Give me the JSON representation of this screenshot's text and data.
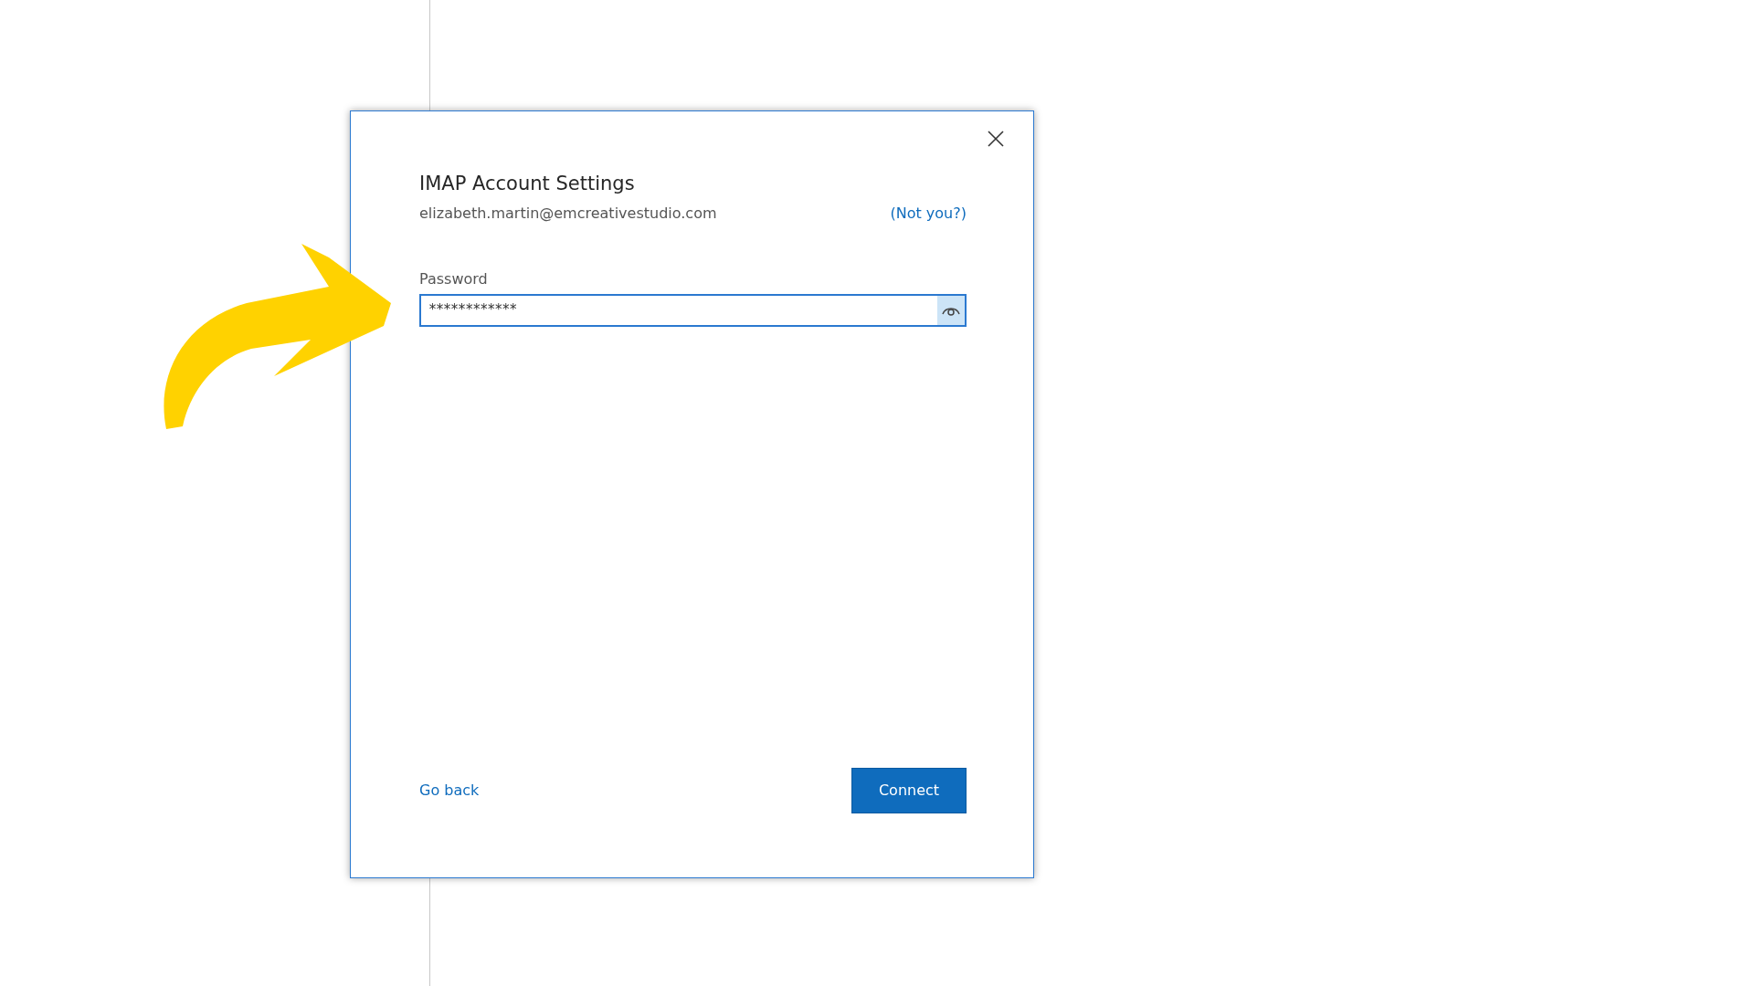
{
  "dialog": {
    "title": "IMAP Account Settings",
    "email": "elizabeth.martin@emcreativestudio.com",
    "not_you_link": "(Not you?)",
    "password": {
      "label": "Password",
      "value": "************"
    },
    "back_link": "Go back",
    "connect_button": "Connect"
  }
}
